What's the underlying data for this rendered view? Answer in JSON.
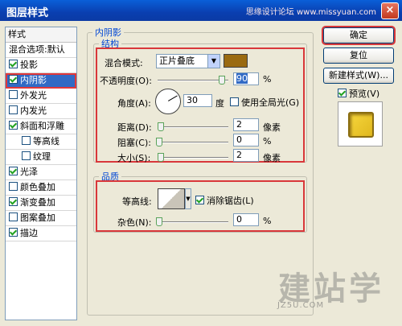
{
  "window": {
    "title": "图层样式",
    "watermark_top": "思缘设计论坛 www.missyuan.com",
    "close": "×"
  },
  "stylelist": {
    "header": "样式",
    "items": [
      {
        "label": "混合选项:默认",
        "checkbox": false,
        "checked": false,
        "selected": false,
        "indent": false
      },
      {
        "label": "投影",
        "checkbox": true,
        "checked": true,
        "selected": false,
        "indent": false
      },
      {
        "label": "内阴影",
        "checkbox": true,
        "checked": true,
        "selected": true,
        "indent": false
      },
      {
        "label": "外发光",
        "checkbox": true,
        "checked": false,
        "selected": false,
        "indent": false
      },
      {
        "label": "内发光",
        "checkbox": true,
        "checked": false,
        "selected": false,
        "indent": false
      },
      {
        "label": "斜面和浮雕",
        "checkbox": true,
        "checked": true,
        "selected": false,
        "indent": false
      },
      {
        "label": "等高线",
        "checkbox": true,
        "checked": false,
        "selected": false,
        "indent": true
      },
      {
        "label": "纹理",
        "checkbox": true,
        "checked": false,
        "selected": false,
        "indent": true
      },
      {
        "label": "光泽",
        "checkbox": true,
        "checked": true,
        "selected": false,
        "indent": false
      },
      {
        "label": "颜色叠加",
        "checkbox": true,
        "checked": false,
        "selected": false,
        "indent": false
      },
      {
        "label": "渐变叠加",
        "checkbox": true,
        "checked": true,
        "selected": false,
        "indent": false
      },
      {
        "label": "图案叠加",
        "checkbox": true,
        "checked": false,
        "selected": false,
        "indent": false
      },
      {
        "label": "描边",
        "checkbox": true,
        "checked": true,
        "selected": false,
        "indent": false
      }
    ]
  },
  "panel": {
    "title": "内阴影",
    "structure": {
      "title": "结构",
      "blend_mode_label": "混合模式:",
      "blend_mode_value": "正片叠底",
      "blend_color": "#9a6a10",
      "opacity_label": "不透明度(O):",
      "opacity_value": "90",
      "opacity_unit": "%",
      "opacity_fraction": 0.9,
      "angle_label": "角度(A):",
      "angle_value": "30",
      "angle_unit": "度",
      "global_light_label": "使用全局光(G)",
      "global_light_checked": false,
      "distance_label": "距离(D):",
      "distance_value": "2",
      "distance_unit": "像素",
      "choke_label": "阻塞(C):",
      "choke_value": "0",
      "choke_unit": "%",
      "size_label": "大小(S):",
      "size_value": "2",
      "size_unit": "像素"
    },
    "quality": {
      "title": "品质",
      "contour_label": "等高线:",
      "antialias_label": "消除锯齿(L)",
      "antialias_checked": true,
      "noise_label": "杂色(N):",
      "noise_value": "0",
      "noise_unit": "%"
    }
  },
  "buttons": {
    "ok": "确定",
    "reset": "复位",
    "new_style": "新建样式(W)...",
    "preview_label": "预览(V)",
    "preview_checked": true
  },
  "watermark": {
    "main": "建站学",
    "sub": "JZ5U.COM"
  }
}
